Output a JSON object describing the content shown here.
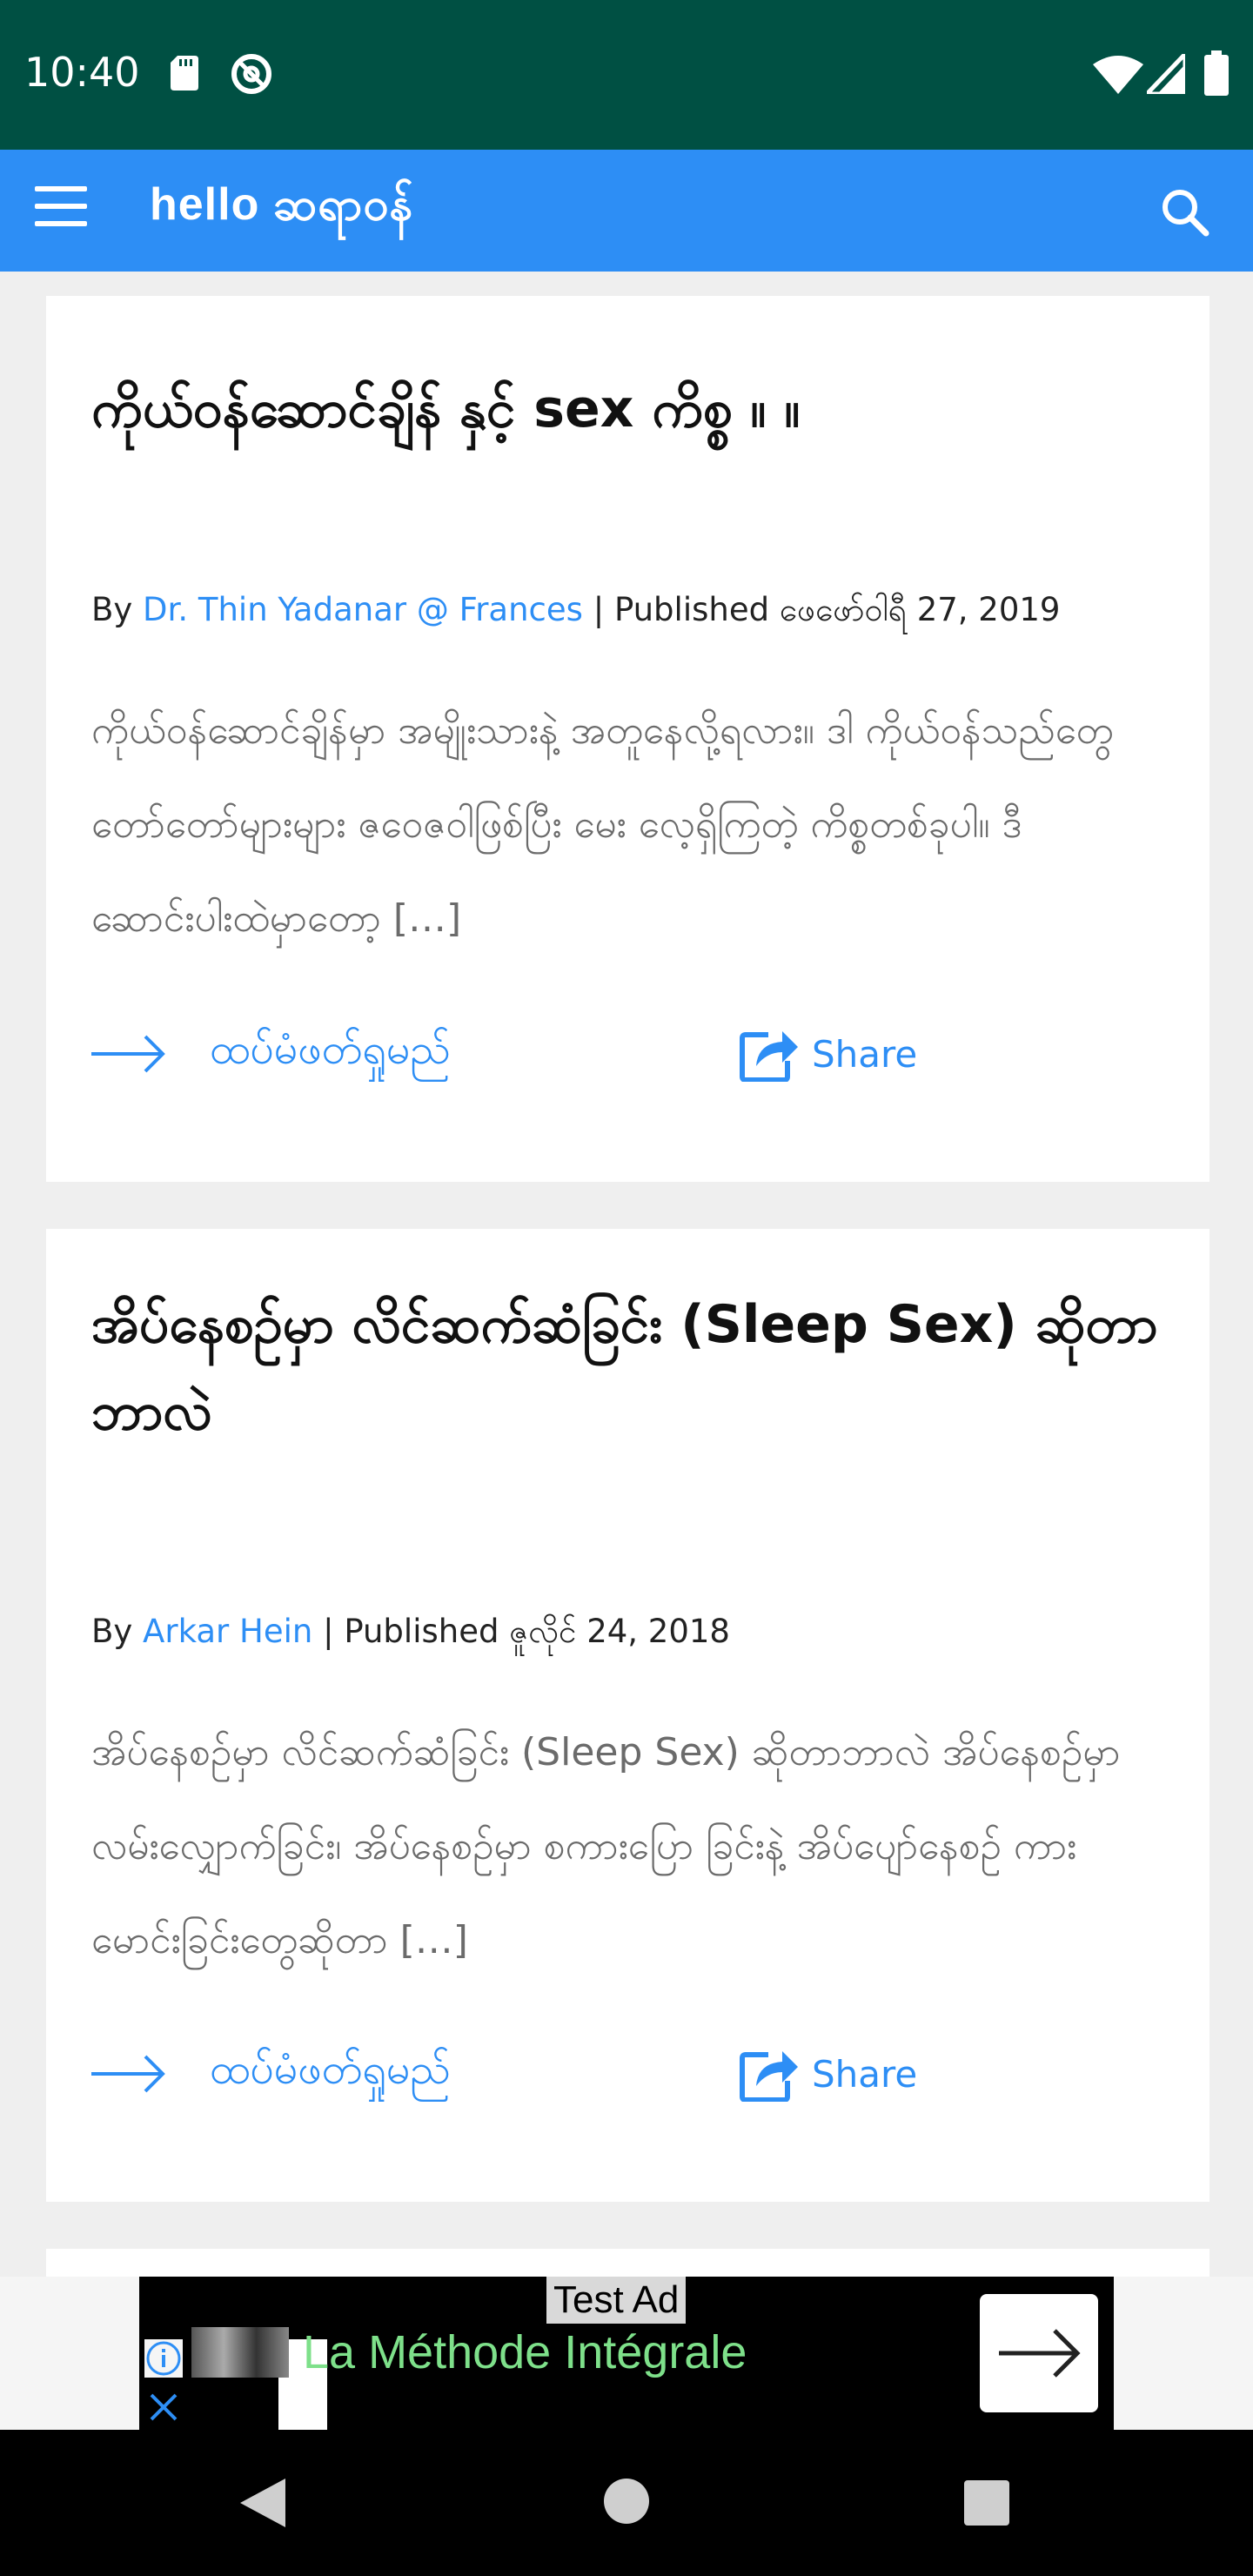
{
  "status_bar": {
    "time": "10:40",
    "icons": [
      "sd-card-icon",
      "at-sign-icon",
      "wifi-icon",
      "cellular-icon",
      "battery-icon"
    ]
  },
  "app_bar": {
    "logo": "hello ဆရာဝန်",
    "menu_icon": "hamburger-menu-icon",
    "search_icon": "search-icon",
    "color": "#2d8ef5"
  },
  "articles": [
    {
      "title": "ကိုယ်ဝန်ဆောင်ချိန် နှင့် sex ကိစ္စ ။ ။",
      "by_label": "By",
      "author": "Dr. Thin Yadanar @ Frances",
      "separator": "|",
      "published_label": "Published",
      "date": "ဖေဖော်ဝါရီ 27, 2019",
      "excerpt": "ကိုယ်ဝန်ဆောင်ချိန်မှာ အမျိုးသားနဲ့ အတူနေလို့ရလား။ ဒါ ကိုယ်ဝန်သည်တွေ တော်တော်များများ ဇဝေဇဝါဖြစ်ပြီး မေး လေ့ရှိကြတဲ့ ကိစ္စတစ်ခုပါ။ ဒီဆောင်းပါးထဲမှာတော့ […]",
      "read_more": "ထပ်မံဖတ်ရှုမည်",
      "share": "Share"
    },
    {
      "title": "အိပ်နေစဉ်မှာ လိင်ဆက်ဆံခြင်း (Sleep Sex) ဆိုတာဘာလဲ",
      "by_label": "By",
      "author": "Arkar Hein",
      "separator": "|",
      "published_label": "Published",
      "date": "ဇူလိုင် 24, 2018",
      "excerpt": "အိပ်နေစဉ်မှာ လိင်ဆက်ဆံခြင်း (Sleep Sex) ဆိုတာဘာလဲ အိပ်နေစဉ်မှာ လမ်းလျှောက်ခြင်း၊ အိပ်နေစဉ်မှာ စကားပြော ခြင်းနဲ့ အိပ်ပျော်နေစဉ် ကားမောင်းခြင်းတွေဆိုတာ […]",
      "read_more": "ထပ်မံဖတ်ရှုမည်",
      "share": "Share"
    }
  ],
  "ad": {
    "badge": "Test Ad",
    "headline": "La Méthode Intégrale",
    "icons": [
      "info-icon",
      "close-icon",
      "arrow-right-icon"
    ]
  },
  "nav_bar": {
    "icons": [
      "back-icon",
      "home-icon",
      "recents-icon"
    ]
  }
}
